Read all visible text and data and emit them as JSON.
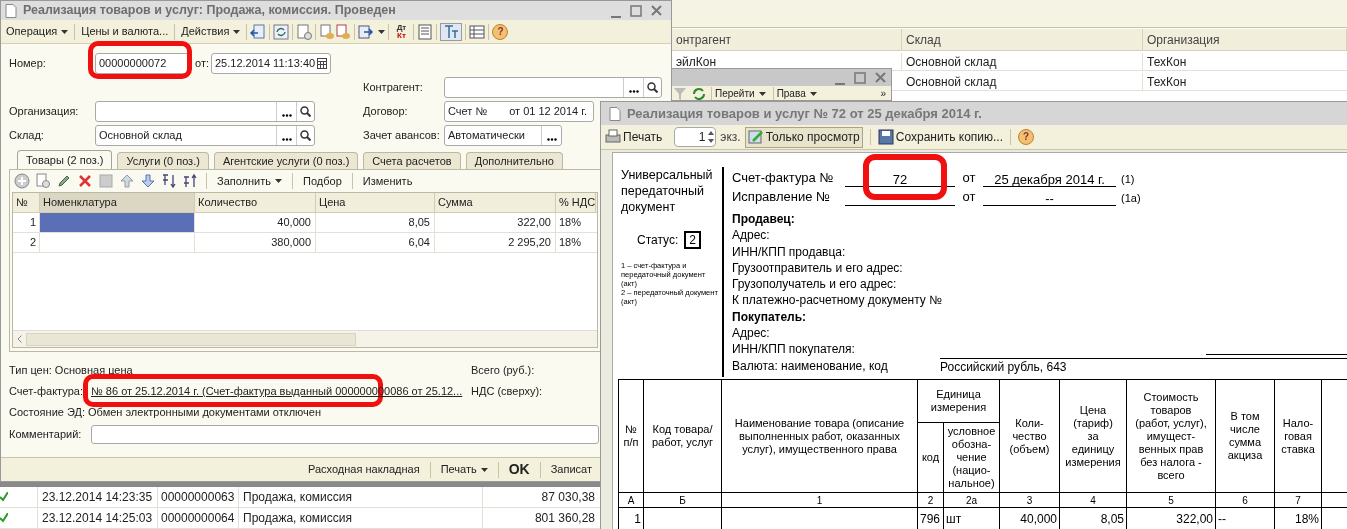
{
  "list_window": {
    "columns": [
      "онтрагент",
      "Склад",
      "Организация"
    ],
    "rows": [
      {
        "counterparty": "эйлКон",
        "warehouse": "Основной склад",
        "organization": "ТехКон"
      },
      {
        "warehouse": "Основной склад",
        "organization": "ТехКон"
      }
    ]
  },
  "journal_window": {
    "toolbar": [
      {
        "label": "Перейти",
        "dropdown": true
      },
      {
        "label": "Права",
        "dropdown": true
      }
    ],
    "overflow": "»"
  },
  "document_window": {
    "title": "Реализация товаров и услуг: Продажа, комиссия. Проведен",
    "menu": [
      {
        "label": "Операция",
        "dropdown": true
      },
      {
        "label": "Цены и валюта...",
        "dropdown": false
      },
      {
        "label": "Действия",
        "dropdown": true
      }
    ],
    "dt_kt": {
      "debit": "Дт",
      "credit": "Кт"
    },
    "help": "?",
    "number": {
      "label": "Номер:",
      "value": "00000000072",
      "date_label": "от:",
      "date": "25.12.2014 11:13:40"
    },
    "left_fields": [
      {
        "label": "Организация:"
      },
      {
        "label": "Склад:",
        "value": "Основной склад"
      }
    ],
    "right_fields": [
      {
        "label": "Контрагент:",
        "kind": "search"
      },
      {
        "label": "Договор:",
        "value": "Счет №",
        "value_2": "от 01 12 2014 г.",
        "kind": "covered"
      },
      {
        "label": "Зачет авансов:",
        "value": "Автоматически",
        "kind": "select"
      }
    ],
    "tabs": [
      {
        "label": "Товары (2 поз.)",
        "selected": true
      },
      {
        "label": "Услуги (0 поз.)",
        "selected": false
      },
      {
        "label": "Агентские услуги (0 поз.)",
        "selected": false
      },
      {
        "label": "Счета расчетов",
        "selected": false
      },
      {
        "label": "Дополнительно",
        "selected": false
      }
    ],
    "table_toolbar": [
      {
        "label": "Заполнить",
        "dropdown": true
      },
      {
        "label": "Подбор",
        "dropdown": false
      },
      {
        "label": "Изменить",
        "dropdown": false
      }
    ],
    "table": {
      "columns": [
        "№",
        "Номенклатура",
        "Количество",
        "Цена",
        "Сумма",
        "% НДС"
      ],
      "rows": [
        {
          "n": "1",
          "quantity": "40,000",
          "price": "8,05",
          "sum": "322,00",
          "vat": "18%",
          "selected": true
        },
        {
          "n": "2",
          "quantity": "380,000",
          "price": "6,04",
          "sum": "2 295,20",
          "vat": "18%",
          "selected": false
        }
      ]
    },
    "price_type": "Тип цен: Основная цена",
    "invoice": {
      "label": "Счет-фактура:",
      "link": "№ 86 от 25.12.2014 г. (Счет-фактура выданный 000000000086 от 25.12..."
    },
    "ed_state": "Состояние ЭД: Обмен электронными документами отключен",
    "totals": [
      "Всего (руб.):",
      "НДС (сверху):"
    ],
    "comment": {
      "label": "Комментарий:"
    },
    "footer_buttons": [
      {
        "label": "Расходная накладная",
        "kind": "plain"
      },
      {
        "label": "Печать",
        "kind": "dropdown"
      },
      {
        "label": "OK",
        "kind": "default"
      },
      {
        "label": "Записат",
        "kind": "plain"
      }
    ]
  },
  "journal_rows": [
    {
      "posted": true,
      "date": "23.12.2014 14:23:35",
      "number": "00000000063",
      "operation": "Продажа, комиссия",
      "amount": "87 030,38"
    },
    {
      "posted": true,
      "date": "23.12.2014 14:25:03",
      "number": "00000000064",
      "operation": "Продажа, комиссия",
      "amount": "801 360,28"
    }
  ],
  "print_window": {
    "title": "Реализация товаров и услуг № 72 от 25 декабря 2014 г.",
    "toolbar": {
      "print": "Печать",
      "copies": "1",
      "copies_unit": "экз.",
      "view_only": {
        "label": "Только просмотр",
        "pressed": true
      },
      "save": "Сохранить копию...",
      "help": "?"
    },
    "doc": {
      "doc_type": "Универсальный передаточный документ",
      "status_label": "Статус:",
      "status": "2",
      "status_note": "1 – счет-фактура и передаточный документ (акт)\n2 – передаточный документ (акт)",
      "header_rows": [
        {
          "label": "Счет-фактура №",
          "number": "72",
          "from": "от",
          "date": "25 декабря 2014 г.",
          "ref": "(1)"
        },
        {
          "label": "Исправление №",
          "from": "от",
          "date": "--",
          "ref": "(1а)"
        }
      ],
      "lines": [
        {
          "kind": "heading",
          "text": "Продавец:"
        },
        {
          "kind": "field",
          "text": "Адрес:"
        },
        {
          "kind": "field",
          "text": "ИНН/КПП продавца:"
        },
        {
          "kind": "field",
          "text": "Грузоотправитель и его адрес:"
        },
        {
          "kind": "field",
          "text": "Грузополучатель и его адрес:"
        },
        {
          "kind": "field",
          "text": "К платежно-расчетному документу №"
        },
        {
          "kind": "heading",
          "text": "Покупатель:"
        },
        {
          "kind": "field",
          "text": "Адрес:"
        },
        {
          "kind": "field",
          "text": "ИНН/КПП покупателя:"
        },
        {
          "kind": "field",
          "text": "Валюта: наименование, код",
          "value": "Российский рубль, 643"
        }
      ],
      "table": {
        "headers": [
          "№\nп/п",
          "Код товара/\nработ, услуг",
          "Наименование товара (описание\nвыполненных работ, оказанных\nуслуг), имущественного права",
          "Единица\nизмерения",
          "код",
          "условное\nобозна-\nчение\n(нацио-\nнальное)",
          "Коли-\nчество\n(объем)",
          "Цена\n(тариф)\nза\nединицу\nизмерения",
          "Стоимость\nтоваров\n(работ, услуг),\nимущест-\nвенных прав\nбез налога -\nвсего",
          "В том\nчисле\nсумма\nакциза",
          "Нало-\nговая\nставка"
        ],
        "column_numbers": [
          "А",
          "Б",
          "1",
          "2",
          "2а",
          "3",
          "4",
          "5",
          "6",
          "7"
        ],
        "rows": [
          {
            "n": "1",
            "unit_code": "796",
            "unit": "шт",
            "quantity": "40,000",
            "price": "8,05",
            "cost": "322,00",
            "excise": "--",
            "rate": "18%"
          }
        ]
      }
    }
  }
}
